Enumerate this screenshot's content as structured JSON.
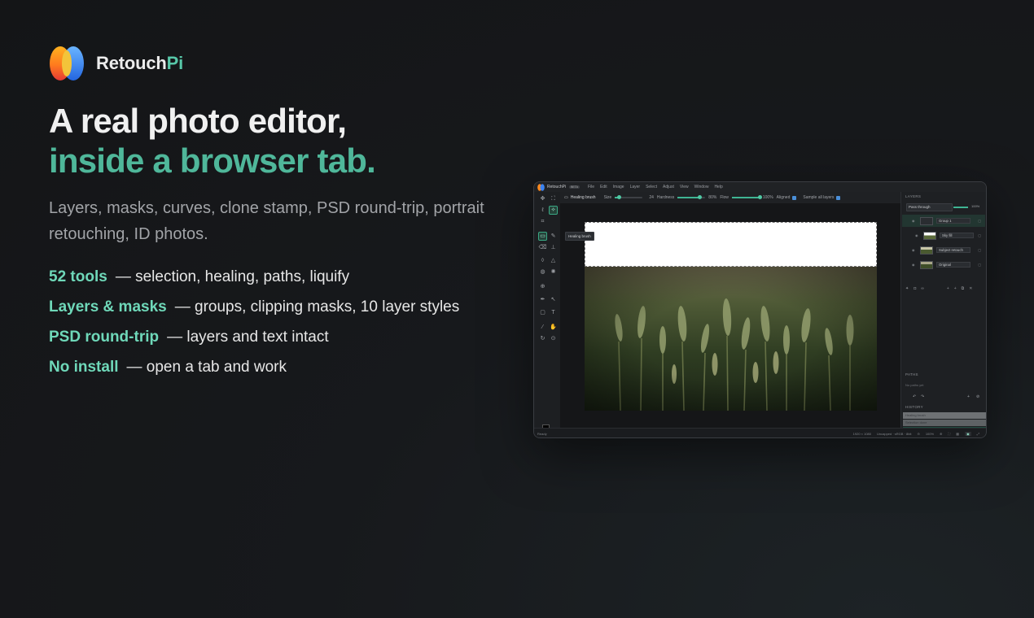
{
  "brand": {
    "name_main": "Retouch",
    "name_accent": "Pi"
  },
  "hero": {
    "line1": "A real photo editor,",
    "line2": "inside a browser tab.",
    "subtitle": "Layers, masks, curves, clone stamp, PSD round-trip, portrait retouching, ID photos."
  },
  "features": [
    {
      "key": "52 tools",
      "desc": "— selection, healing, paths, liquify"
    },
    {
      "key": "Layers & masks",
      "desc": "— groups, clipping masks, 10 layer styles"
    },
    {
      "key": "PSD round-trip",
      "desc": "— layers and text intact"
    },
    {
      "key": "No install",
      "desc": "— open a tab and work"
    }
  ],
  "app": {
    "menubar": {
      "app_name": "RetouchPi",
      "badge": "BETA",
      "items": [
        "File",
        "Edit",
        "Image",
        "Layer",
        "Select",
        "Adjust",
        "View",
        "Window",
        "Help"
      ]
    },
    "options": {
      "tool_name": "Healing brush",
      "size_label": "Size",
      "size_value": "24",
      "size_fraction": 0.15,
      "hardness_label": "Hardness",
      "hardness_value": "80%",
      "hardness_fraction": 0.8,
      "flow_label": "Flow",
      "flow_value": "100%",
      "flow_fraction": 1.0,
      "aligned_label": "Aligned",
      "sample_label": "Sample all layers"
    },
    "tooltip": "Healing brush",
    "layers_panel": {
      "title": "LAYERS",
      "blend_mode": "Pass through",
      "opacity": "100%",
      "layers": [
        {
          "name": "Group 1"
        },
        {
          "name": "Sky fill"
        },
        {
          "name": "Subject retouch"
        },
        {
          "name": "Original"
        }
      ]
    },
    "paths_panel": {
      "title": "PATHS",
      "empty_text": "No paths yet"
    },
    "history_panel": {
      "title": "HISTORY",
      "items": [
        "Healing brush",
        "Selection done",
        "Merge layers"
      ]
    },
    "status": {
      "left": "Ready",
      "dimensions": "1920 × 1080",
      "meta": "Uncapped · sRGB · 8bit",
      "zoom": "100%"
    }
  },
  "colors": {
    "accent": "#57c7a8",
    "feature_key": "#6fd8b9",
    "background": "#17191c"
  }
}
